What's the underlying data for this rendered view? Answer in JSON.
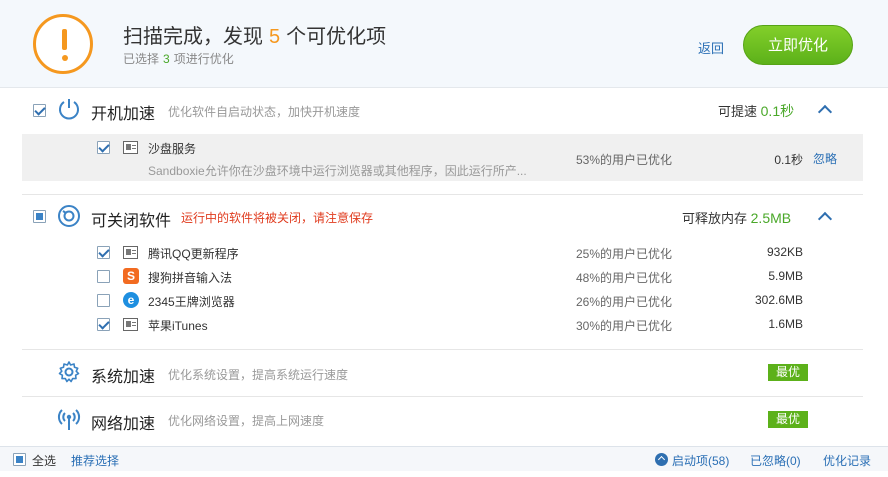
{
  "header": {
    "title_prefix": "扫描完成，发现",
    "count": "5",
    "title_suffix": "个可优化项",
    "sub_prefix": "已选择",
    "selected": "3",
    "sub_suffix": "项进行优化",
    "back": "返回",
    "optimize": "立即优化",
    "warn_color": "#f5981f",
    "accent_green": "#5cb11a"
  },
  "startup": {
    "title": "开机加速",
    "desc": "优化软件自启动状态，加快开机速度",
    "gain_label": "可提速",
    "gain_value": "0.1秒",
    "item": {
      "name": "沙盘服务",
      "desc": "Sandboxie允许你在沙盘环境中运行浏览器或其他程序，因此运行所产...",
      "percent": "53%的用户已优化",
      "time": "0.1秒",
      "ignore": "忽略"
    }
  },
  "closable": {
    "title": "可关闭软件",
    "warning": "运行中的软件将被关闭，请注意保存",
    "gain_label": "可释放内存",
    "gain_value": "2.5MB",
    "items": [
      {
        "name": "腾讯QQ更新程序",
        "percent": "25%的用户已优化",
        "size": "932KB",
        "checked": true,
        "icon": "generic-app-icon"
      },
      {
        "name": "搜狗拼音输入法",
        "percent": "48%的用户已优化",
        "size": "5.9MB",
        "checked": false,
        "icon": "sogou-icon"
      },
      {
        "name": "2345王牌浏览器",
        "percent": "26%的用户已优化",
        "size": "302.6MB",
        "checked": false,
        "icon": "browser-e-icon"
      },
      {
        "name": "苹果iTunes",
        "percent": "30%的用户已优化",
        "size": "1.6MB",
        "checked": true,
        "icon": "generic-app-icon"
      }
    ]
  },
  "system": {
    "title": "系统加速",
    "desc": "优化系统设置，提高系统运行速度",
    "badge": "最优"
  },
  "network": {
    "title": "网络加速",
    "desc": "优化网络设置，提高上网速度",
    "badge": "最优"
  },
  "footer": {
    "select_all": "全选",
    "recommend": "推荐选择",
    "startup_items": "启动项(58)",
    "ignored": "已忽略(0)",
    "history": "优化记录"
  }
}
